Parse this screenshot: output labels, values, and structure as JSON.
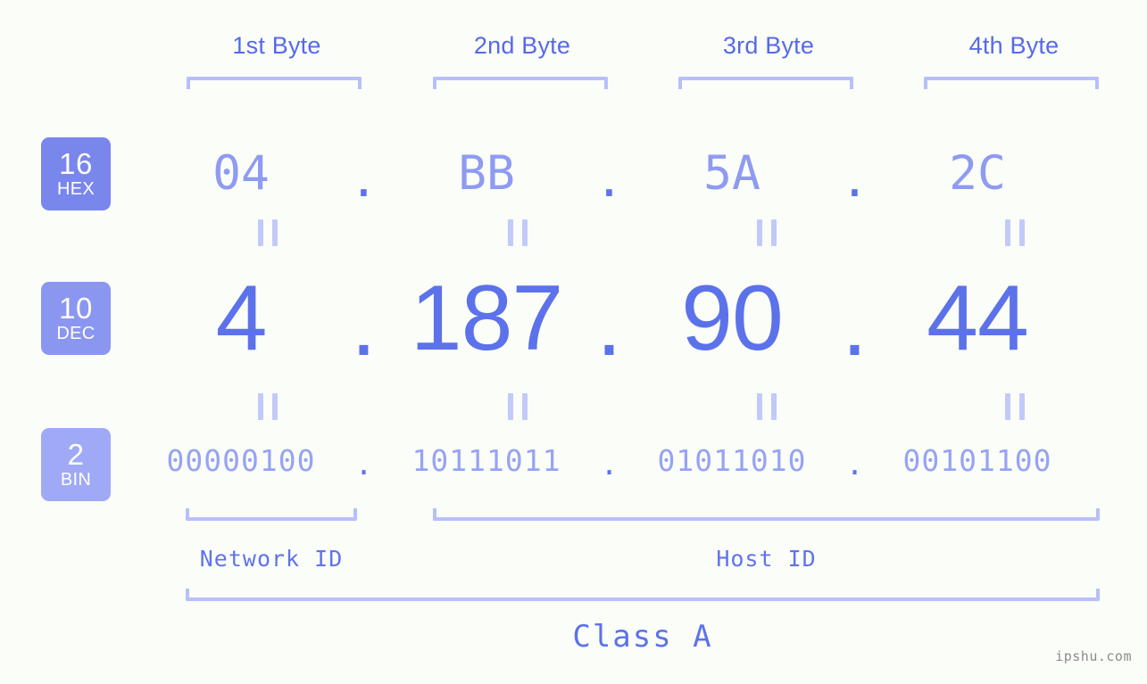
{
  "meta": {
    "background_color": "#fbfdf8",
    "accent_color": "#5c72ea",
    "muted_accent_color": "#b6c0fb",
    "watermark": "ipshu.com"
  },
  "byte_headers": [
    {
      "label": "1st Byte"
    },
    {
      "label": "2nd Byte"
    },
    {
      "label": "3rd Byte"
    },
    {
      "label": "4th Byte"
    }
  ],
  "rows": {
    "hex": {
      "badge_number": "16",
      "badge_radix": "HEX",
      "badge_color": "#7986ec",
      "separator": ".",
      "values": [
        "04",
        "BB",
        "5A",
        "2C"
      ]
    },
    "dec": {
      "badge_number": "10",
      "badge_radix": "DEC",
      "badge_color": "#8b96f0",
      "separator": ".",
      "values": [
        "4",
        "187",
        "90",
        "44"
      ]
    },
    "bin": {
      "badge_number": "2",
      "badge_radix": "BIN",
      "badge_color": "#9fa9f6",
      "separator": ".",
      "values": [
        "00000100",
        "10111011",
        "01011010",
        "00101100"
      ]
    }
  },
  "equality_marks": {
    "symbol": "=",
    "count_per_gap": 4
  },
  "footer": {
    "network_id_label": "Network ID",
    "host_id_label": "Host ID",
    "class_label": "Class A"
  }
}
